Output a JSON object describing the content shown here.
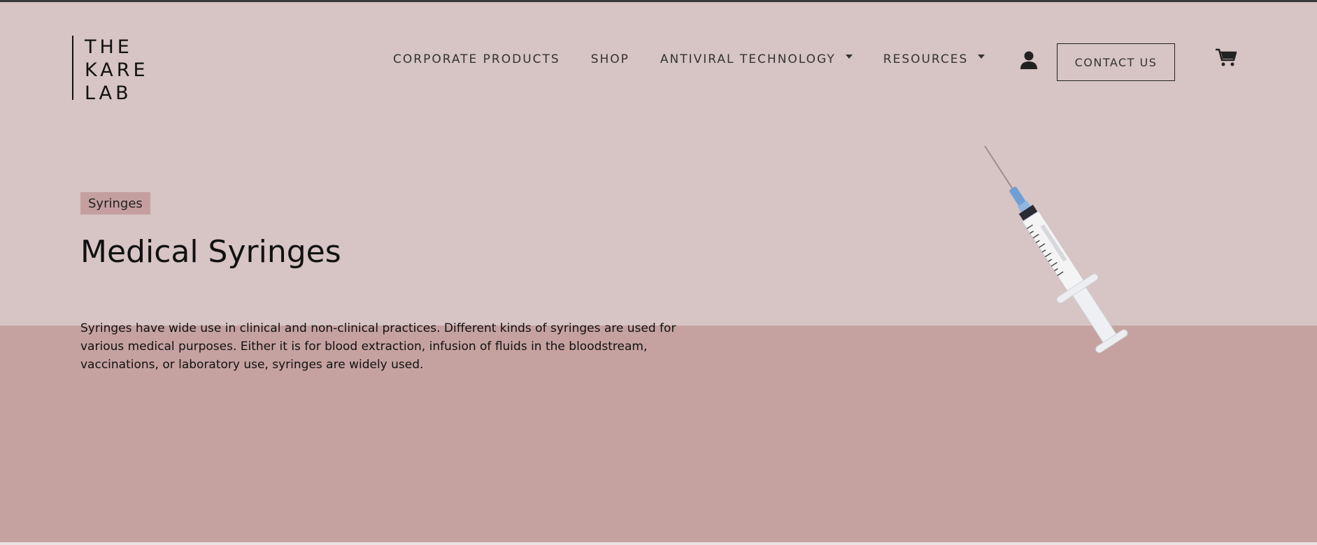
{
  "brand": {
    "logo_lines": [
      "THE",
      "KARE",
      "LAB"
    ]
  },
  "nav": {
    "items": [
      {
        "label": "CORPORATE PRODUCTS",
        "has_dropdown": false
      },
      {
        "label": "SHOP",
        "has_dropdown": false
      },
      {
        "label": "ANTIVIRAL TECHNOLOGY",
        "has_dropdown": true
      },
      {
        "label": "RESOURCES",
        "has_dropdown": true
      }
    ],
    "account_icon": "user-icon",
    "contact_label": "CONTACT US",
    "cart_icon": "cart-icon"
  },
  "hero": {
    "badge": "Syringes",
    "title": "Medical Syringes",
    "description": "Syringes have wide use in clinical and non-clinical practices. Different kinds of syringes are used for various medical purposes. Either it is for blood extraction, infusion of fluids in the bloodstream, vaccinations, or laboratory use, syringes are widely used.",
    "image": "syringe-image"
  },
  "colors": {
    "background_top": "#d7c4c4",
    "background_bottom": "#c5a2a0",
    "badge_bg": "#c59f9f",
    "text": "#111111"
  }
}
